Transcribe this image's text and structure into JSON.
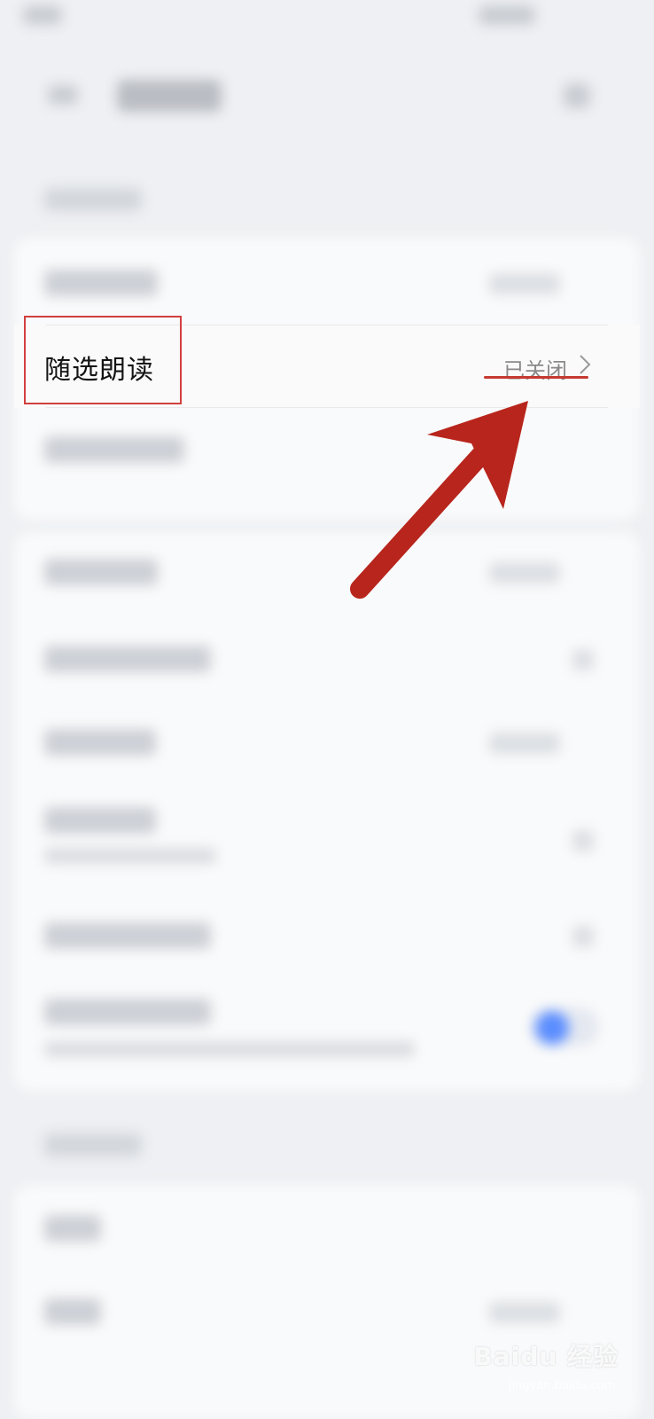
{
  "setting_row": {
    "label": "随选朗读",
    "value": "已关闭"
  },
  "icons": {
    "chevron": "chevron-right-icon",
    "watermark": "baidu-jingyan-logo"
  },
  "colors": {
    "highlight": "#d23f3f",
    "arrow": "#b8251c",
    "toggle": "#5b8dff"
  },
  "watermark": {
    "text": "Baidu 经验",
    "sub": "jingyan.baidu.com"
  }
}
